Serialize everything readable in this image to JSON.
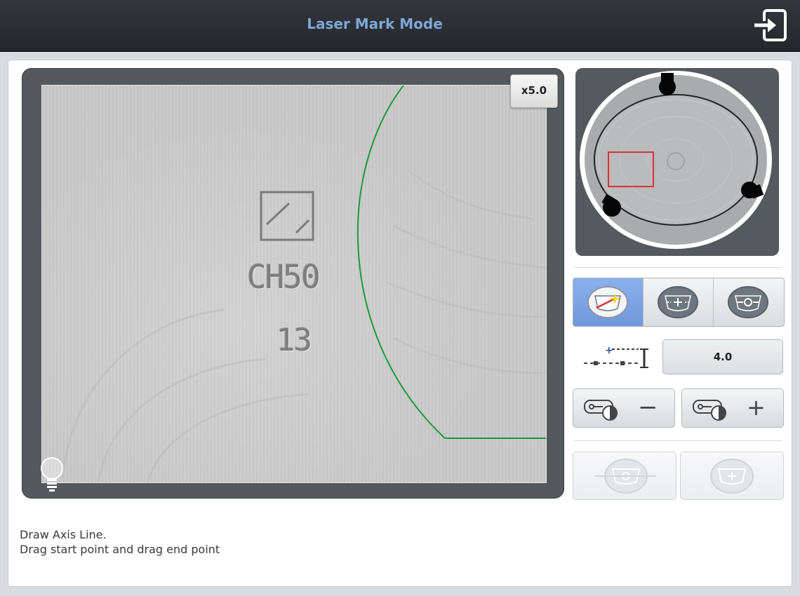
{
  "header": {
    "title": "Laser Mark Mode",
    "exit_icon": "exit-icon"
  },
  "viewer": {
    "zoom_label": "x5.0",
    "engraving": {
      "line1": "CH50",
      "line2": "13"
    },
    "light_icon": "lightbulb-icon",
    "overlay_color": "#1a9a3a"
  },
  "overview": {
    "selection_color": "#d8323a"
  },
  "tools": {
    "mode_buttons": [
      {
        "icon": "draw-axis-icon",
        "active": true
      },
      {
        "icon": "center-cross-icon",
        "active": false
      },
      {
        "icon": "center-circle-icon",
        "active": false
      }
    ],
    "offset_value": "4.0",
    "brightness_decrease_label": "−",
    "brightness_increase_label": "+"
  },
  "status": {
    "line1": "Draw Axis Line.",
    "line2": "Drag start point and drag end point"
  },
  "colors": {
    "accent": "#7fa6d6",
    "active_segment": "#7b9fe0"
  }
}
